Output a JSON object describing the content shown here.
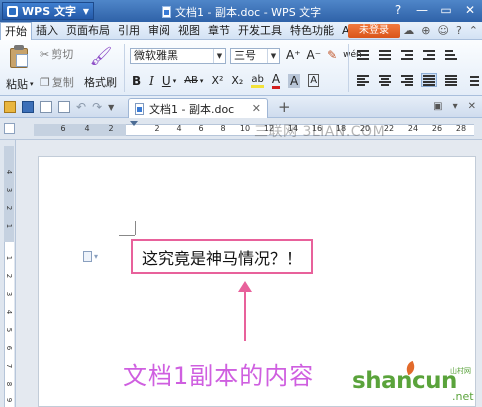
{
  "titlebar": {
    "app_label": "WPS 文字",
    "doc_title": "文档1 - 副本.doc - WPS 文字",
    "controls": [
      "?",
      "—",
      "▭",
      "✕"
    ]
  },
  "menubar": {
    "items": [
      "开始",
      "插入",
      "页面布局",
      "引用",
      "审阅",
      "视图",
      "章节",
      "开发工具",
      "特色功能",
      "Acro"
    ],
    "login_label": "未登录",
    "right_icons": [
      "☁",
      "⊕",
      "☺",
      "?",
      "⌃"
    ]
  },
  "ribbon": {
    "paste_label": "粘贴",
    "cut_label": "剪切",
    "copy_label": "复制",
    "format_painter_label": "格式刷",
    "font_name": "微软雅黑",
    "font_size": "三号",
    "grow_font": "A⁺",
    "shrink_font": "A⁻",
    "clear_format": "✎",
    "phonetic": "wén",
    "bold": "B",
    "italic": "I",
    "underline": "U",
    "strike": "AB",
    "superscript": "X²",
    "subscript": "X₂",
    "highlight": "ab",
    "font_color": "A",
    "char_shading": "A",
    "char_border": "A"
  },
  "quickbar": {
    "tab_label": "文档1 - 副本.doc",
    "tab_close": "✕",
    "tab_add": "+"
  },
  "ruler": {
    "marks": [
      "6",
      "4",
      "2",
      "2",
      "4",
      "6",
      "8",
      "10",
      "12",
      "14",
      "16",
      "18",
      "20",
      "22",
      "24",
      "26",
      "28"
    ],
    "v_marks": [
      "4",
      "3",
      "2",
      "1",
      "1",
      "2",
      "3",
      "4",
      "5",
      "6",
      "7",
      "8",
      "9"
    ]
  },
  "watermark": "三联网 3LIAN.COM",
  "document": {
    "content_text": "这究竟是神马情况？！",
    "caption": "文档1副本的内容"
  },
  "logo": {
    "text": "shancun",
    "sub": "山村网",
    "net": ".net"
  },
  "colors": {
    "title_bar": "#2f62a8",
    "login_button": "#e0612a",
    "highlight_border": "#e8619b",
    "caption": "#cf5fe0",
    "logo": "#5aa33b"
  }
}
